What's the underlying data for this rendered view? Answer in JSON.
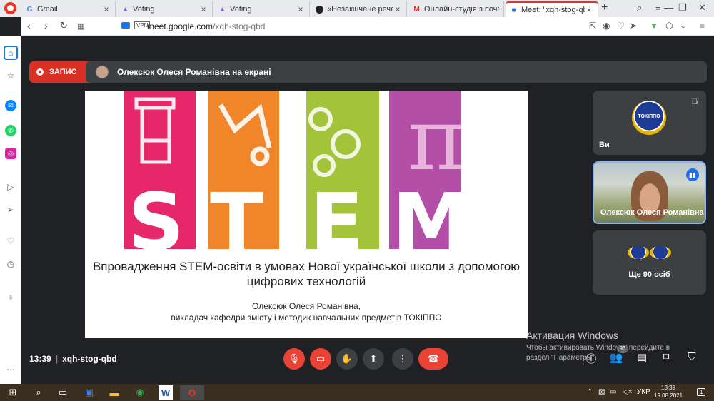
{
  "browser": {
    "tabs": [
      {
        "label": "Gmail",
        "icon": "gmail-icon"
      },
      {
        "label": "Voting",
        "icon": "voting-icon"
      },
      {
        "label": "Voting",
        "icon": "voting-icon"
      },
      {
        "label": "«Незакінчене речення»",
        "icon": "avatar-icon"
      },
      {
        "label": "Онлайн-студія з почат",
        "icon": "gmail-icon"
      },
      {
        "label": "Meet: \"xqh-stog-qbd\"",
        "icon": "meet-icon"
      }
    ],
    "close_glyph": "×",
    "new_tab_glyph": "+",
    "vpn_label": "VPN",
    "url_host": "meet.google.com",
    "url_path": "/xqh-stog-qbd"
  },
  "meet": {
    "record_label": "ЗАПИС",
    "presenter_banner": "Олексюк Олеся Романівна на екрані",
    "slide": {
      "title": "Впровадження STEM-освіти в умовах Нової української школи з допомогою цифрових технологій",
      "author_name": "Олексюк Олеся Романівна,",
      "author_role": "викладач кафедри змісту і методик навчальних предметів ТОКІППО",
      "stem_letters": [
        "S",
        "T",
        "E",
        "M"
      ],
      "logo_glyph": "π"
    },
    "tiles": [
      {
        "name": "Ви",
        "logo_text": "ТОКІППО"
      },
      {
        "name": "Олексюк Олеся Романівна"
      },
      {
        "name": "Ще 90 осіб"
      }
    ],
    "time": "13:39",
    "meeting_code": "xqh-stog-qbd",
    "participants_badge": "93",
    "windows_activation": {
      "title": "Активация Windows",
      "line1": "Чтобы активировать Windows, перейдите в",
      "line2": "раздел \"Параметры\"."
    }
  },
  "taskbar": {
    "lang": "УКР",
    "time": "13:39",
    "date": "19.08.2021",
    "notif_count": "1"
  },
  "colors": {
    "stripe_magenta": "#e6286b",
    "stripe_orange": "#f0852a",
    "stripe_lime": "#a3c43a",
    "stripe_purple": "#b44fa8",
    "stripe_pink_light": "#e8b4dc",
    "record_red": "#d93025",
    "meet_dark": "#202124"
  }
}
